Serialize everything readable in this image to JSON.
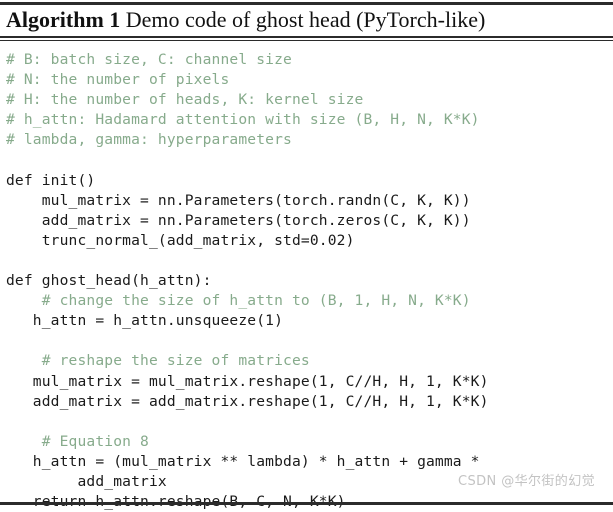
{
  "header": {
    "label": "Algorithm 1",
    "caption": "Demo code of ghost head (PyTorch-like)"
  },
  "code": {
    "lines": [
      {
        "kind": "comment",
        "text": "# B: batch size, C: channel size"
      },
      {
        "kind": "comment",
        "text": "# N: the number of pixels"
      },
      {
        "kind": "comment",
        "text": "# H: the number of heads, K: kernel size"
      },
      {
        "kind": "comment",
        "text": "# h_attn: Hadamard attention with size (B, H, N, K*K)"
      },
      {
        "kind": "comment",
        "text": "# lambda, gamma: hyperparameters"
      },
      {
        "kind": "blank",
        "text": ""
      },
      {
        "kind": "code",
        "text": "def init()"
      },
      {
        "kind": "code",
        "text": "    mul_matrix = nn.Parameters(torch.randn(C, K, K))"
      },
      {
        "kind": "code",
        "text": "    add_matrix = nn.Parameters(torch.zeros(C, K, K))"
      },
      {
        "kind": "code",
        "text": "    trunc_normal_(add_matrix, std=0.02)"
      },
      {
        "kind": "blank",
        "text": ""
      },
      {
        "kind": "code",
        "text": "def ghost_head(h_attn):"
      },
      {
        "kind": "comment",
        "text": "    # change the size of h_attn to (B, 1, H, N, K*K)"
      },
      {
        "kind": "code",
        "text": "   h_attn = h_attn.unsqueeze(1)"
      },
      {
        "kind": "blank",
        "text": ""
      },
      {
        "kind": "comment",
        "text": "    # reshape the size of matrices"
      },
      {
        "kind": "code",
        "text": "   mul_matrix = mul_matrix.reshape(1, C//H, H, 1, K*K)"
      },
      {
        "kind": "code",
        "text": "   add_matrix = add_matrix.reshape(1, C//H, H, 1, K*K)"
      },
      {
        "kind": "blank",
        "text": ""
      },
      {
        "kind": "comment",
        "text": "    # Equation 8"
      },
      {
        "kind": "code",
        "text": "   h_attn = (mul_matrix ** lambda) * h_attn + gamma *"
      },
      {
        "kind": "code",
        "text": "        add_matrix"
      },
      {
        "kind": "code",
        "text": "   return h_attn.reshape(B, C, N, K*K)"
      }
    ]
  },
  "watermark": {
    "text": "CSDN @华尔街的幻觉"
  },
  "colors": {
    "comment": "#87ab8c",
    "code": "#1a1a1a",
    "rule": "#2b2b2b",
    "watermark": "#c3c3c3"
  }
}
